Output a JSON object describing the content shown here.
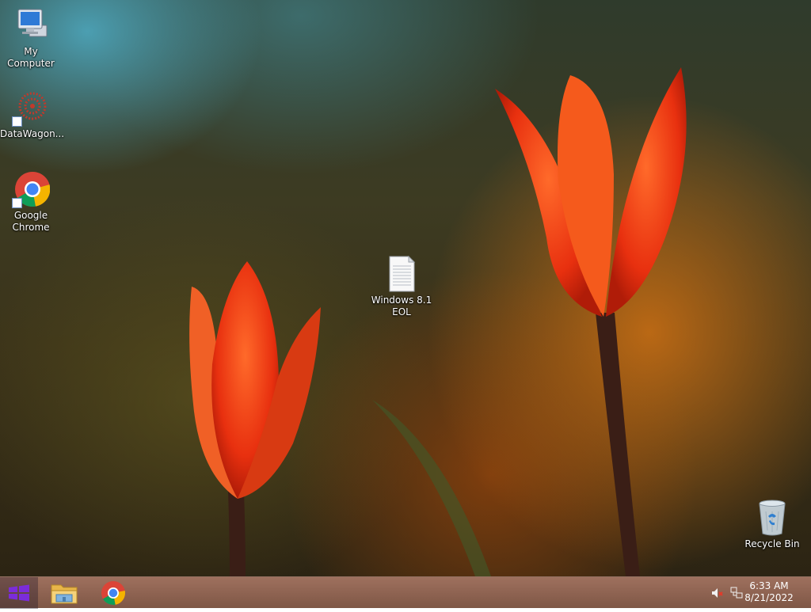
{
  "desktop": {
    "icons": [
      {
        "name": "my-computer",
        "label": "My Computer",
        "icon": "computer-monitor-icon"
      },
      {
        "name": "datawagon",
        "label": "DataWagon...",
        "icon": "datawagon-logo-icon",
        "shortcut": true
      },
      {
        "name": "google-chrome",
        "label": "Google Chrome",
        "icon": "chrome-icon",
        "shortcut": true
      },
      {
        "name": "windows-eol",
        "label": "Windows 8.1 EOL",
        "icon": "text-document-icon"
      },
      {
        "name": "recycle-bin",
        "label": "Recycle Bin",
        "icon": "recycle-bin-icon"
      }
    ]
  },
  "taskbar": {
    "start_icon": "windows-logo-icon",
    "pinned": [
      {
        "name": "file-explorer",
        "icon": "folder-icon"
      },
      {
        "name": "chrome",
        "icon": "chrome-icon"
      }
    ],
    "tray": {
      "volume_icon": "speaker-muted-icon",
      "network_icon": "network-icon"
    },
    "clock": {
      "time": "6:33 AM",
      "date": "8/21/2022"
    }
  },
  "colors": {
    "taskbar": "#8a5c47",
    "start_logo": "#7b2cd9"
  }
}
